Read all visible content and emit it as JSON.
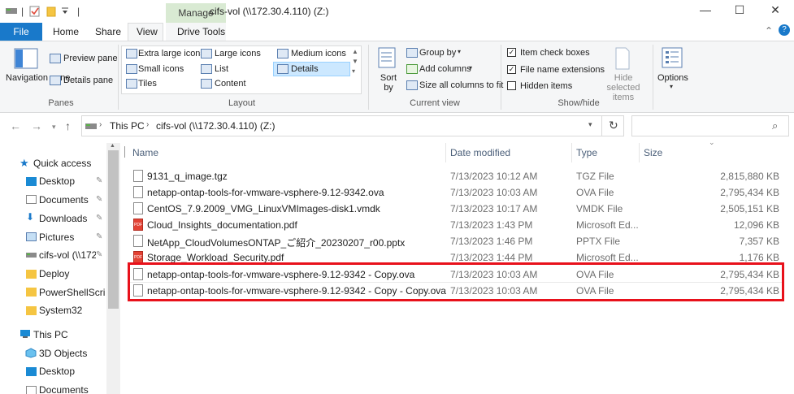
{
  "window": {
    "title": "cifs-vol (\\\\172.30.4.110) (Z:)",
    "contextual_tab": "Manage",
    "controls": {
      "minimize": "—",
      "maximize": "☐",
      "close": "✕"
    }
  },
  "tabs": [
    "File",
    "Home",
    "Share",
    "View",
    "Drive Tools"
  ],
  "ribbon": {
    "panes": {
      "navigation_pane": "Navigation pane",
      "preview_pane": "Preview pane",
      "details_pane": "Details pane",
      "group": "Panes"
    },
    "layout": {
      "extra_large_icons": "Extra large icons",
      "large_icons": "Large icons",
      "medium_icons": "Medium icons",
      "small_icons": "Small icons",
      "list": "List",
      "details": "Details",
      "tiles": "Tiles",
      "content": "Content",
      "group": "Layout"
    },
    "current_view": {
      "sort_by": "Sort by",
      "group_by": "Group by",
      "add_columns": "Add columns",
      "size_all_columns": "Size all columns to fit",
      "group": "Current view"
    },
    "show_hide": {
      "item_check_boxes": "Item check boxes",
      "item_check_boxes_checked": true,
      "file_name_extensions": "File name extensions",
      "file_name_extensions_checked": true,
      "hidden_items": "Hidden items",
      "hidden_items_checked": false,
      "hide_selected_items": "Hide selected items",
      "group": "Show/hide"
    },
    "options": "Options"
  },
  "address": {
    "crumbs": [
      "This PC",
      "cifs-vol (\\\\172.30.4.110) (Z:)"
    ],
    "search_placeholder": ""
  },
  "nav_pane": {
    "quick_access": "Quick access",
    "items": [
      {
        "label": "Desktop",
        "pinned": true
      },
      {
        "label": "Documents",
        "pinned": true
      },
      {
        "label": "Downloads",
        "pinned": true
      },
      {
        "label": "Pictures",
        "pinned": true
      },
      {
        "label": "cifs-vol (\\\\172",
        "pinned": true
      },
      {
        "label": "Deploy",
        "pinned": false
      },
      {
        "label": "PowerShellScript",
        "pinned": false
      },
      {
        "label": "System32",
        "pinned": false
      }
    ],
    "this_pc": "This PC",
    "this_pc_items": [
      "3D Objects",
      "Desktop",
      "Documents"
    ]
  },
  "columns": {
    "name": "Name",
    "date": "Date modified",
    "type": "Type",
    "size": "Size"
  },
  "files": [
    {
      "name": "9131_q_image.tgz",
      "date": "7/13/2023 10:12 AM",
      "type": "TGZ File",
      "size": "2,815,880 KB",
      "icon": "file-icon"
    },
    {
      "name": "netapp-ontap-tools-for-vmware-vsphere-9.12-9342.ova",
      "date": "7/13/2023 10:03 AM",
      "type": "OVA File",
      "size": "2,795,434 KB",
      "icon": "file-icon"
    },
    {
      "name": "CentOS_7.9.2009_VMG_LinuxVMImages-disk1.vmdk",
      "date": "7/13/2023 10:17 AM",
      "type": "VMDK File",
      "size": "2,505,151 KB",
      "icon": "file-icon"
    },
    {
      "name": "Cloud_Insights_documentation.pdf",
      "date": "7/13/2023 1:43 PM",
      "type": "Microsoft Ed...",
      "size": "12,096 KB",
      "icon": "pdf-icon"
    },
    {
      "name": "NetApp_CloudVolumesONTAP_ご紹介_20230207_r00.pptx",
      "date": "7/13/2023 1:46 PM",
      "type": "PPTX File",
      "size": "7,357 KB",
      "icon": "file-icon"
    },
    {
      "name": "Storage_Workload_Security.pdf",
      "date": "7/13/2023 1:44 PM",
      "type": "Microsoft Ed...",
      "size": "1,176 KB",
      "icon": "pdf-icon"
    },
    {
      "name": "netapp-ontap-tools-for-vmware-vsphere-9.12-9342 - Copy.ova",
      "date": "7/13/2023 10:03 AM",
      "type": "OVA File",
      "size": "2,795,434 KB",
      "icon": "file-icon"
    },
    {
      "name": "netapp-ontap-tools-for-vmware-vsphere-9.12-9342 - Copy - Copy.ova",
      "date": "7/13/2023 10:03 AM",
      "type": "OVA File",
      "size": "2,795,434 KB",
      "icon": "file-icon"
    }
  ],
  "highlight_color": "#e8111b",
  "accent": "#1979ca"
}
